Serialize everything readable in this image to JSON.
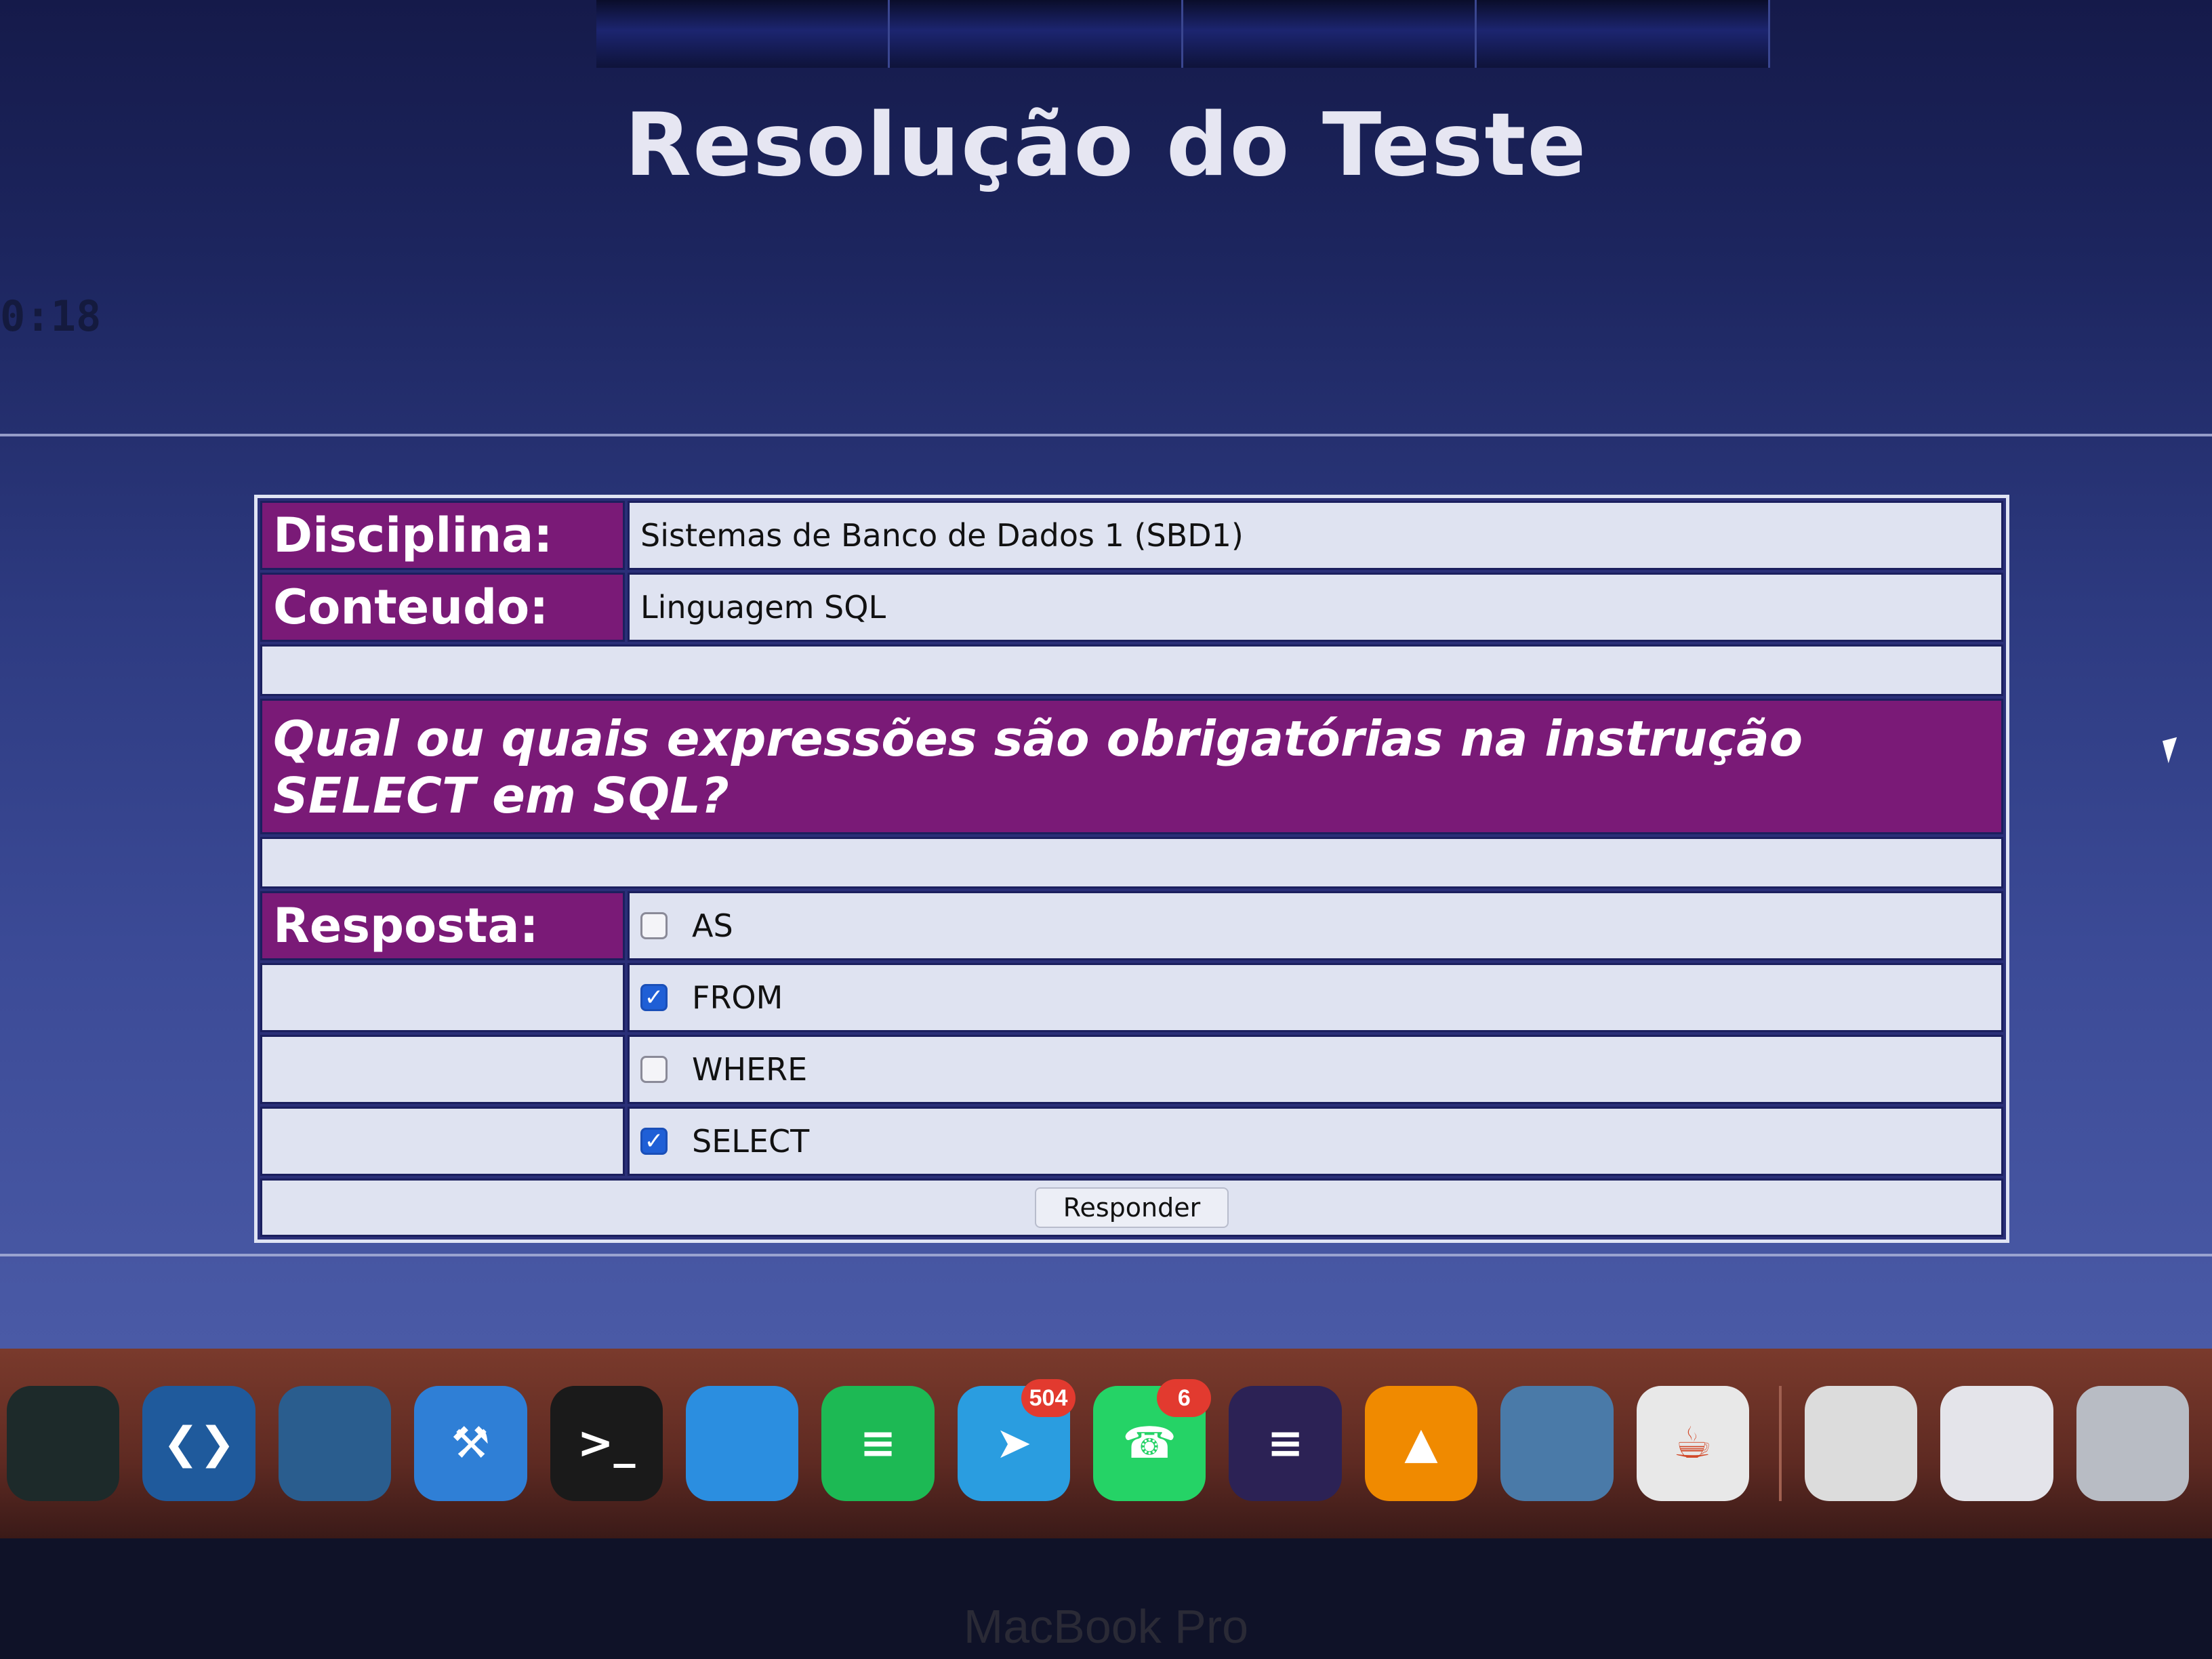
{
  "page": {
    "title": "Resolução do Teste",
    "timer": "0:18"
  },
  "quiz": {
    "discipline_label": "Disciplina:",
    "discipline_value": "Sistemas de Banco de Dados 1 (SBD1)",
    "content_label": "Conteudo:",
    "content_value": "Linguagem SQL",
    "question": "Qual ou quais expressões são obrigatórias na instrução SELECT em SQL?",
    "answer_label": "Resposta:",
    "options": [
      {
        "label": "AS",
        "checked": false
      },
      {
        "label": "FROM",
        "checked": true
      },
      {
        "label": "WHERE",
        "checked": false
      },
      {
        "label": "SELECT",
        "checked": true
      }
    ],
    "submit_label": "Responder"
  },
  "dock": {
    "apps": [
      {
        "name": "filmora-icon",
        "color": "#1d2a2a"
      },
      {
        "name": "vscode-icon",
        "color": "#1f5a9c"
      },
      {
        "name": "mysql-workbench-icon",
        "color": "#2a5d8e"
      },
      {
        "name": "xcode-icon",
        "color": "#2f7fd6"
      },
      {
        "name": "terminal-icon",
        "color": "#1a1a1a"
      },
      {
        "name": "docker-icon",
        "color": "#2b8ee0"
      },
      {
        "name": "spotify-icon",
        "color": "#1db954"
      },
      {
        "name": "telegram-icon",
        "color": "#2a9de0"
      },
      {
        "name": "whatsapp-icon",
        "color": "#25d366"
      },
      {
        "name": "eclipse-icon",
        "color": "#2c2255"
      },
      {
        "name": "vlc-icon",
        "color": "#f08a00"
      },
      {
        "name": "preview-icon",
        "color": "#4a7aa8"
      },
      {
        "name": "java-icon",
        "color": "#e8e8e8"
      },
      {
        "name": "document-icon",
        "color": "#dcdcdc"
      },
      {
        "name": "window-icon",
        "color": "#e4e4ea"
      },
      {
        "name": "trash-icon",
        "color": "#b8bcc4"
      }
    ],
    "telegram_badge": "504",
    "whatsapp_badge": "6"
  },
  "device": {
    "bezel_label": "MacBook Pro"
  }
}
